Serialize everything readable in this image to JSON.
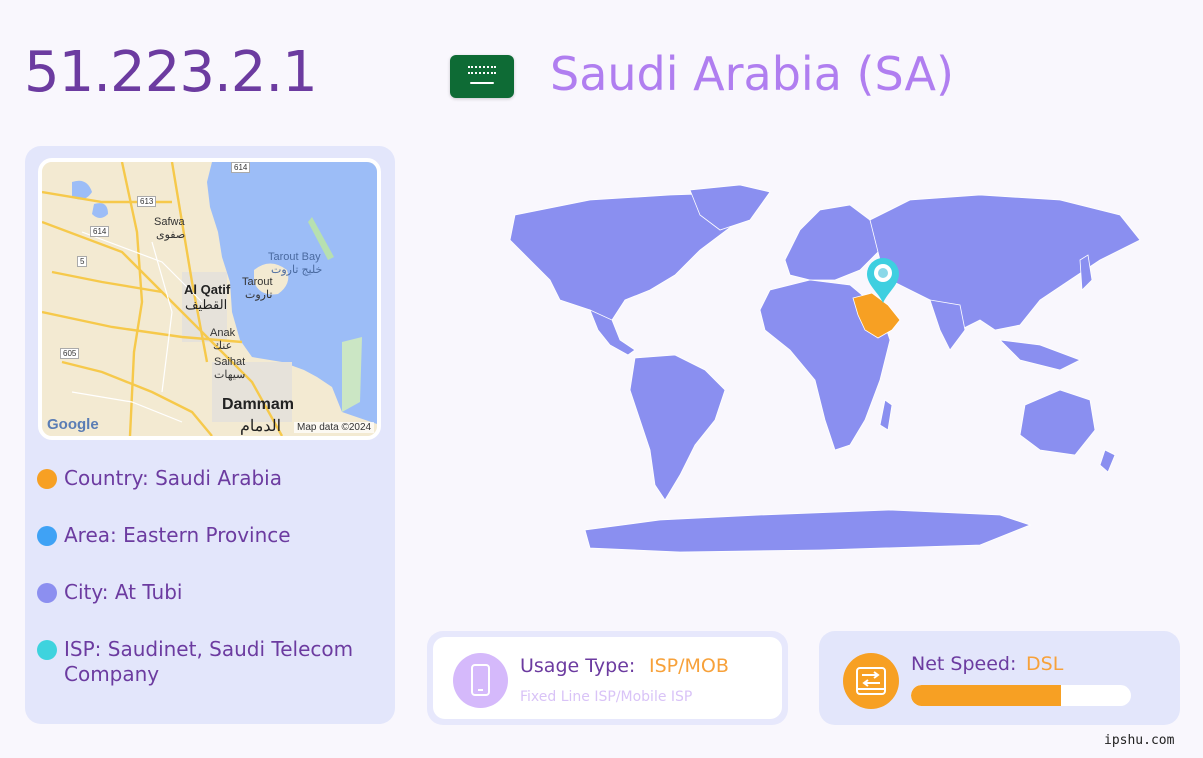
{
  "header": {
    "ip": "51.223.2.1",
    "country_title": "Saudi Arabia (SA)"
  },
  "mini_map": {
    "labels": {
      "safwa": "Safwa",
      "safwa_ar": "صفوى",
      "tarout_bay": "Tarout Bay",
      "tarout_bay_ar": "خليج تاروت",
      "tarout": "Tarout",
      "tarout_ar": "تاروت",
      "al_qatif": "Al Qatif",
      "al_qatif_ar": "القطيف",
      "anak": "Anak",
      "anak_ar": "عنك",
      "saihat": "Saihat",
      "saihat_ar": "سيهات",
      "dammam": "Dammam",
      "dammam_ar": "الدمام"
    },
    "road_shields": [
      "614",
      "613",
      "614",
      "5",
      "605"
    ],
    "google": "Google",
    "attribution": "Map data ©2024"
  },
  "info": {
    "country": "Country: Saudi Arabia",
    "area": "Area: Eastern Province",
    "city": "City: At Tubi",
    "isp": "ISP: Saudinet, Saudi Telecom Company"
  },
  "usage": {
    "label": "Usage Type:",
    "value": "ISP/MOB",
    "sub": "Fixed Line ISP/Mobile ISP"
  },
  "speed": {
    "label": "Net Speed:",
    "value": "DSL",
    "level": 0.68
  },
  "brand": "ipshu.com",
  "colors": {
    "ip": "#6c3ba0",
    "title": "#b07ef0",
    "card": "#e3e6fb",
    "country_dot": "#f7a023",
    "area_dot": "#3fa2f5",
    "city_dot": "#8c8ff0",
    "isp_dot": "#3ed3de",
    "land": "#8a8ff0",
    "highlight": "#f7a023",
    "pin": "#3ecfe0"
  },
  "icons": {
    "usage": "mobile-phone-icon",
    "speed": "network-transfer-icon",
    "pin": "location-pin-icon"
  }
}
